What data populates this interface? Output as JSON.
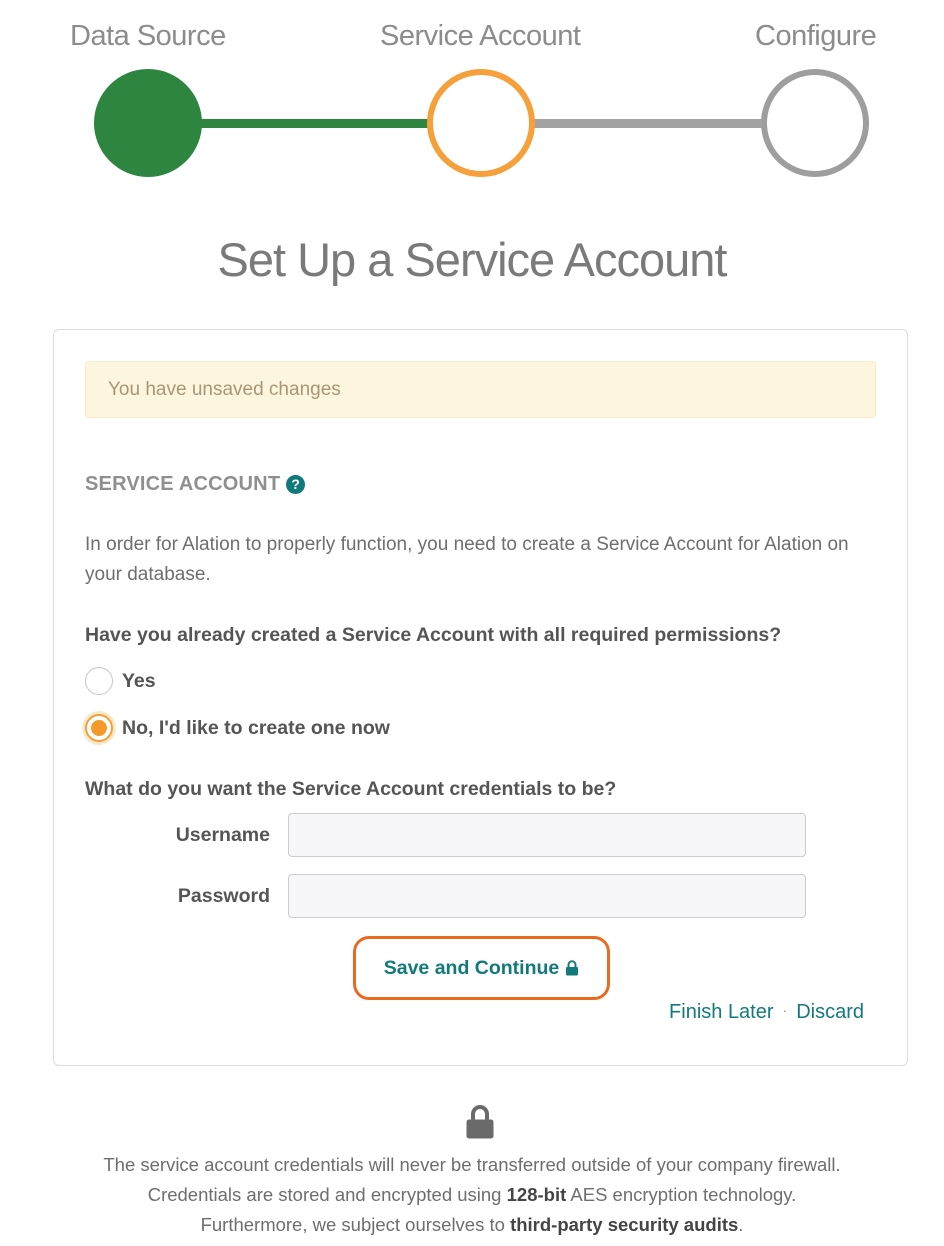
{
  "stepper": {
    "steps": [
      {
        "label": "Data Source",
        "state": "complete"
      },
      {
        "label": "Service Account",
        "state": "current"
      },
      {
        "label": "Configure",
        "state": "upcoming"
      }
    ],
    "colors": {
      "complete": "#2e8540",
      "current": "#f5a03b",
      "upcoming": "#9e9e9e"
    }
  },
  "page_title": "Set Up a Service Account",
  "alert": {
    "text": "You have unsaved changes"
  },
  "section": {
    "heading": "SERVICE ACCOUNT",
    "help_icon": "question-circle-icon",
    "description": "In order for Alation to properly function, you need to create a Service Account for Alation on your database."
  },
  "question1": {
    "text": "Have you already created a Service Account with all required permissions?",
    "options": [
      {
        "label": "Yes",
        "checked": false
      },
      {
        "label": "No, I'd like to create one now",
        "checked": true
      }
    ]
  },
  "question2": {
    "text": "What do you want the Service Account credentials to be?"
  },
  "fields": {
    "username": {
      "label": "Username",
      "value": "",
      "placeholder": ""
    },
    "password": {
      "label": "Password",
      "value": "",
      "placeholder": ""
    }
  },
  "actions": {
    "save_label": "Save and Continue",
    "save_icon": "lock-icon",
    "finish_later": "Finish Later",
    "separator": "·",
    "discard": "Discard"
  },
  "footer": {
    "icon": "lock-icon",
    "line1": "The service account credentials will never be transferred outside of your company firewall.",
    "line2_pre": "Credentials are stored and encrypted using ",
    "line2_bold": "128-bit",
    "line2_post": " AES encryption technology.",
    "line3_pre": "Furthermore, we subject ourselves to ",
    "line3_bold": "third-party security audits",
    "line3_post": "."
  }
}
